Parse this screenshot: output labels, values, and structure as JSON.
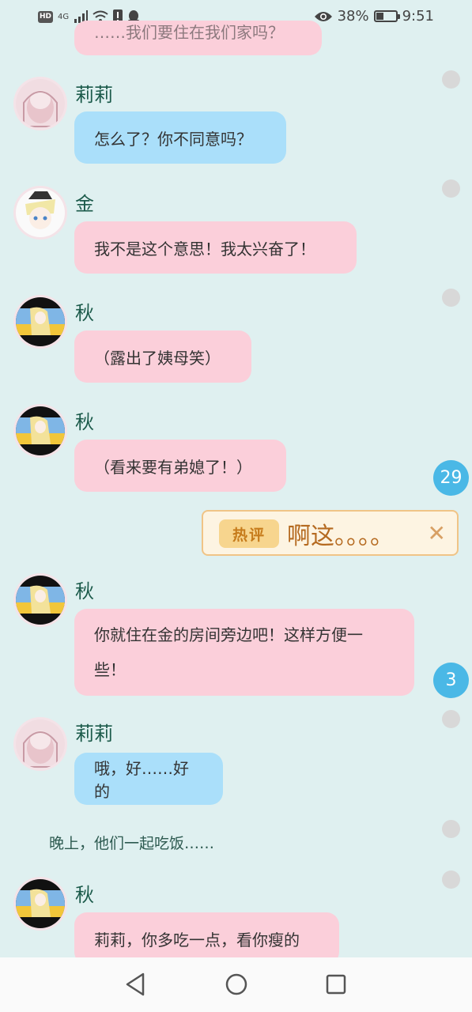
{
  "status": {
    "left_indicators": [
      "HD",
      "4G"
    ],
    "battery": "38%",
    "battery_level": 0.38,
    "time": "9:51"
  },
  "top_fragment": "……我们要住在我们家吗？",
  "messages": [
    {
      "name": "莉莉",
      "text": "怎么了？你不同意吗？"
    },
    {
      "name": "金",
      "text": "我不是这个意思！我太兴奋了！"
    },
    {
      "name": "秋",
      "text": "（露出了姨母笑）"
    },
    {
      "name": "秋",
      "text": "（看来要有弟媳了！）"
    },
    {
      "name": "秋",
      "text_line1": "你就住在金的房间旁边吧！这样方便一",
      "text_line2": "些！"
    },
    {
      "name": "莉莉",
      "text": "哦，好……好的"
    },
    {
      "name": "秋",
      "text": "莉莉，你多吃一点，看你瘦的"
    }
  ],
  "narration": "晚上，他们一起吃饭……",
  "badges": [
    "29",
    "3"
  ],
  "hot_comment": {
    "tag": "热评",
    "text": "啊这。。。。",
    "close": "✕"
  },
  "icons": {
    "eye": "eye-icon",
    "wifi": "wifi-icon",
    "signal": "signal-icon",
    "back": "back-triangle-icon",
    "home": "home-circle-icon",
    "recent": "recent-square-icon"
  },
  "colors": {
    "background": "#dff0f0",
    "pink_bubble": "#fbcfda",
    "blue_bubble": "#aadffa",
    "badge": "#4ab8e6",
    "name": "#1b5a4a"
  }
}
